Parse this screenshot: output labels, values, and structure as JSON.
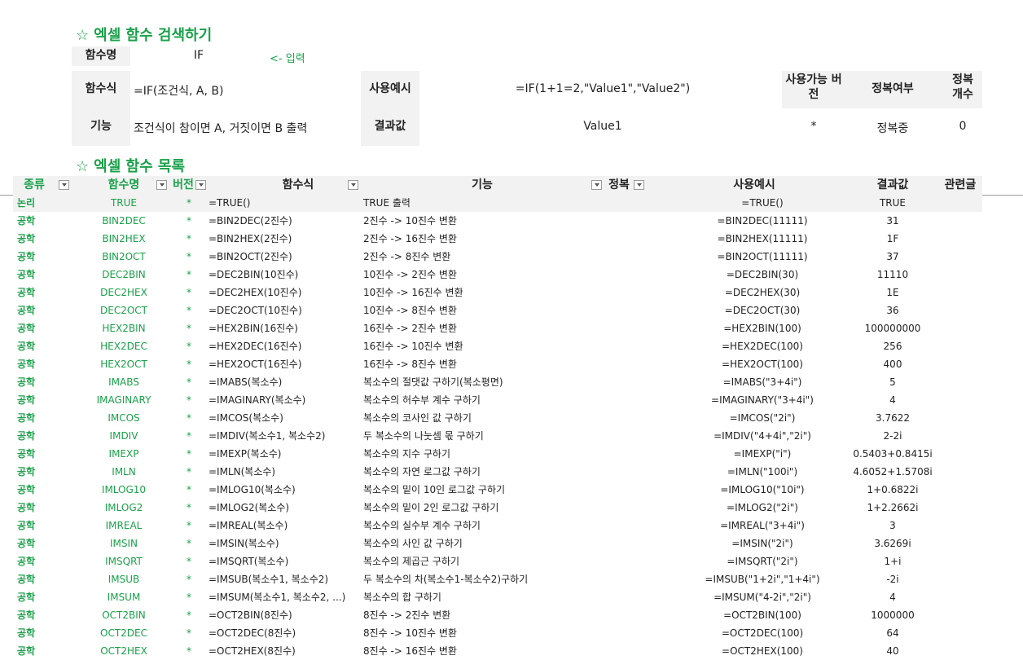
{
  "search_title": "엑셀 함수 검색하기",
  "list_title": "엑셀 함수 목록",
  "star": "☆",
  "search": {
    "name_label": "함수명",
    "name_value": "IF",
    "hint": "<- 입력",
    "syntax_label": "함수식",
    "syntax_value": "=IF(조건식, A, B)",
    "example_label": "사용예시",
    "example_value": "=IF(1+1=2,\"Value1\",\"Value2\")",
    "version_label": "사용가능 버전",
    "version_value": "*",
    "conquer_label": "정복여부",
    "conquer_value": "정복중",
    "count_label": "정복 개수",
    "count_value": "0",
    "func_label": "기능",
    "func_value": "조건식이 참이면 A, 거짓이면 B 출력",
    "result_label": "결과값",
    "result_value": "Value1"
  },
  "table": {
    "headers": {
      "category": "종류",
      "name": "함수명",
      "version": "버전",
      "syntax": "함수식",
      "desc": "기능",
      "conquer": "정복",
      "example": "사용예시",
      "result": "결과값",
      "related": "관련글"
    },
    "rows": [
      {
        "cat": "논리",
        "name": "TRUE",
        "ver": "*",
        "syn": "=TRUE()",
        "desc": "TRUE 출력",
        "ex": "=TRUE()",
        "res": "TRUE"
      },
      {
        "cat": "공학",
        "name": "BIN2DEC",
        "ver": "*",
        "syn": "=BIN2DEC(2진수)",
        "desc": "2진수 -> 10진수 변환",
        "ex": "=BIN2DEC(11111)",
        "res": "31"
      },
      {
        "cat": "공학",
        "name": "BIN2HEX",
        "ver": "*",
        "syn": "=BIN2HEX(2진수)",
        "desc": "2진수 -> 16진수 변환",
        "ex": "=BIN2HEX(11111)",
        "res": "1F"
      },
      {
        "cat": "공학",
        "name": "BIN2OCT",
        "ver": "*",
        "syn": "=BIN2OCT(2진수)",
        "desc": "2진수 -> 8진수 변환",
        "ex": "=BIN2OCT(11111)",
        "res": "37"
      },
      {
        "cat": "공학",
        "name": "DEC2BIN",
        "ver": "*",
        "syn": "=DEC2BIN(10진수)",
        "desc": "10진수 -> 2진수 변환",
        "ex": "=DEC2BIN(30)",
        "res": "11110"
      },
      {
        "cat": "공학",
        "name": "DEC2HEX",
        "ver": "*",
        "syn": "=DEC2HEX(10진수)",
        "desc": "10진수 -> 16진수 변환",
        "ex": "=DEC2HEX(30)",
        "res": "1E"
      },
      {
        "cat": "공학",
        "name": "DEC2OCT",
        "ver": "*",
        "syn": "=DEC2OCT(10진수)",
        "desc": "10진수 -> 8진수 변환",
        "ex": "=DEC2OCT(30)",
        "res": "36"
      },
      {
        "cat": "공학",
        "name": "HEX2BIN",
        "ver": "*",
        "syn": "=HEX2BIN(16진수)",
        "desc": "16진수 -> 2진수 변환",
        "ex": "=HEX2BIN(100)",
        "res": "100000000"
      },
      {
        "cat": "공학",
        "name": "HEX2DEC",
        "ver": "*",
        "syn": "=HEX2DEC(16진수)",
        "desc": "16진수 -> 10진수 변환",
        "ex": "=HEX2DEC(100)",
        "res": "256"
      },
      {
        "cat": "공학",
        "name": "HEX2OCT",
        "ver": "*",
        "syn": "=HEX2OCT(16진수)",
        "desc": "16진수 -> 8진수 변환",
        "ex": "=HEX2OCT(100)",
        "res": "400"
      },
      {
        "cat": "공학",
        "name": "IMABS",
        "ver": "*",
        "syn": "=IMABS(복소수)",
        "desc": "복소수의 절댓값 구하기(복소평면)",
        "ex": "=IMABS(\"3+4i\")",
        "res": "5"
      },
      {
        "cat": "공학",
        "name": "IMAGINARY",
        "ver": "*",
        "syn": "=IMAGINARY(복소수)",
        "desc": "복소수의 허수부 계수 구하기",
        "ex": "=IMAGINARY(\"3+4i\")",
        "res": "4"
      },
      {
        "cat": "공학",
        "name": "IMCOS",
        "ver": "*",
        "syn": "=IMCOS(복소수)",
        "desc": "복소수의 코사인 값 구하기",
        "ex": "=IMCOS(\"2i\")",
        "res": "3.7622"
      },
      {
        "cat": "공학",
        "name": "IMDIV",
        "ver": "*",
        "syn": "=IMDIV(복소수1, 복소수2)",
        "desc": "두 복소수의 나눗셈 몫 구하기",
        "ex": "=IMDIV(\"4+4i\",\"2i\")",
        "res": "2-2i"
      },
      {
        "cat": "공학",
        "name": "IMEXP",
        "ver": "*",
        "syn": "=IMEXP(복소수)",
        "desc": "복소수의 지수 구하기",
        "ex": "=IMEXP(\"i\")",
        "res": "0.5403+0.8415i"
      },
      {
        "cat": "공학",
        "name": "IMLN",
        "ver": "*",
        "syn": "=IMLN(복소수)",
        "desc": "복소수의 자연 로그값 구하기",
        "ex": "=IMLN(\"100i\")",
        "res": "4.6052+1.5708i"
      },
      {
        "cat": "공학",
        "name": "IMLOG10",
        "ver": "*",
        "syn": "=IMLOG10(복소수)",
        "desc": "복소수의 밑이 10인 로그값 구하기",
        "ex": "=IMLOG10(\"10i\")",
        "res": "1+0.6822i"
      },
      {
        "cat": "공학",
        "name": "IMLOG2",
        "ver": "*",
        "syn": "=IMLOG2(복소수)",
        "desc": "복소수의 밑이 2인 로그값 구하기",
        "ex": "=IMLOG2(\"2i\")",
        "res": "1+2.2662i"
      },
      {
        "cat": "공학",
        "name": "IMREAL",
        "ver": "*",
        "syn": "=IMREAL(복소수)",
        "desc": "복소수의 실수부 계수 구하기",
        "ex": "=IMREAL(\"3+4i\")",
        "res": "3"
      },
      {
        "cat": "공학",
        "name": "IMSIN",
        "ver": "*",
        "syn": "=IMSIN(복소수)",
        "desc": "복소수의 사인 값 구하기",
        "ex": "=IMSIN(\"2i\")",
        "res": "3.6269i"
      },
      {
        "cat": "공학",
        "name": "IMSQRT",
        "ver": "*",
        "syn": "=IMSQRT(복소수)",
        "desc": "복소수의 제곱근 구하기",
        "ex": "=IMSQRT(\"2i\")",
        "res": "1+i"
      },
      {
        "cat": "공학",
        "name": "IMSUB",
        "ver": "*",
        "syn": "=IMSUB(복소수1, 복소수2)",
        "desc": "두 복소수의 차(복소수1-복소수2)구하기",
        "ex": "=IMSUB(\"1+2i\",\"1+4i\")",
        "res": "-2i"
      },
      {
        "cat": "공학",
        "name": "IMSUM",
        "ver": "*",
        "syn": "=IMSUM(복소수1, 복소수2, ...)",
        "desc": "복소수의 합 구하기",
        "ex": "=IMSUM(\"4-2i\",\"2i\")",
        "res": "4"
      },
      {
        "cat": "공학",
        "name": "OCT2BIN",
        "ver": "*",
        "syn": "=OCT2BIN(8진수)",
        "desc": "8진수 -> 2진수 변환",
        "ex": "=OCT2BIN(100)",
        "res": "1000000"
      },
      {
        "cat": "공학",
        "name": "OCT2DEC",
        "ver": "*",
        "syn": "=OCT2DEC(8진수)",
        "desc": "8진수 -> 10진수 변환",
        "ex": "=OCT2DEC(100)",
        "res": "64"
      },
      {
        "cat": "공학",
        "name": "OCT2HEX",
        "ver": "*",
        "syn": "=OCT2HEX(8진수)",
        "desc": "8진수 -> 16진수 변환",
        "ex": "=OCT2HEX(100)",
        "res": "40"
      }
    ]
  }
}
